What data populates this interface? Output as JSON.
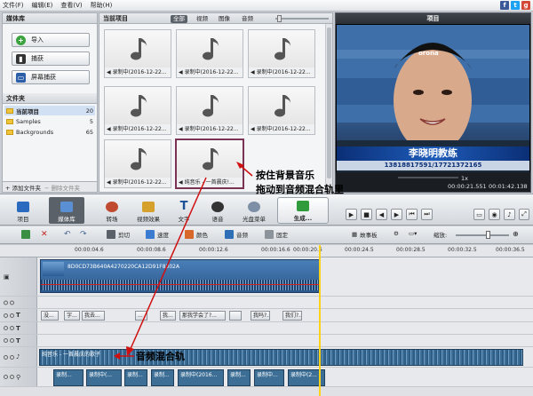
{
  "menu": [
    "文件(F)",
    "编辑(E)",
    "查看(V)",
    "帮助(H)"
  ],
  "social": [
    {
      "label": "f",
      "color": "#3b5998"
    },
    {
      "label": "t",
      "color": "#1da1f2"
    },
    {
      "label": "g",
      "color": "#d34836"
    }
  ],
  "media_library": {
    "title": "媒体库",
    "buttons": [
      "导入",
      "捕获",
      "屏幕捕获"
    ],
    "folders_title": "文件夹",
    "folders": [
      {
        "name": "当前项目",
        "count": "20"
      },
      {
        "name": "Samples",
        "count": "5"
      },
      {
        "name": "Backgrounds",
        "count": "65"
      }
    ],
    "add_folder": "添加文件夹",
    "delete_folder": "删除文件夹"
  },
  "project": {
    "title": "当前项目",
    "filters": [
      "全部",
      "视频",
      "图像",
      "音频"
    ],
    "thumbs": [
      "录制中(2016-12-22...",
      "录制中(2016-12-22...",
      "录制中(2016-12-22...",
      "录制中(2016-12-22...",
      "录制中(2016-12-22...",
      "录制中(2016-12-22...",
      "录制中(2016-12-22...",
      "纯音乐 - 一首晨庆!..."
    ]
  },
  "preview": {
    "title": "项目",
    "video_text": {
      "name": "李晓明教练",
      "phone": "13818817591/17721372165",
      "cap": "orona"
    },
    "speed": "1x",
    "time_current": "00:00:21.551",
    "time_total": "00:01:42.138"
  },
  "toolbar": {
    "buttons": [
      "项目",
      "媒体库",
      "转场",
      "视频效果",
      "文字",
      "语音",
      "光盘菜单",
      "生成..."
    ]
  },
  "timeline": {
    "tools": [
      "剪切",
      "速度",
      "颜色",
      "音频",
      "固定"
    ],
    "storyboard": "故事板",
    "zoom": "缩放:",
    "ruler": [
      "00:00:04.6",
      "00:00:08.6",
      "00:00:12.6",
      "00:00:16.6",
      "00:00:20.6",
      "00:00:24.5",
      "00:00:28.5",
      "00:00:32.5",
      "00:00:36.5"
    ],
    "video_clip": "8D0CD73B640A4270220CA12D91F8302A",
    "text_clips": [
      "没...",
      "字...",
      "我去...",
      "...",
      "我...",
      "那我学会了?...",
      "",
      "我吗?...",
      "我们?..."
    ],
    "audio_clip": "纯音乐 - 一首晨庆的歌子",
    "rec_clips": [
      "录制...",
      "录制中(...",
      "录制...",
      "录制...",
      "录制中(2016...",
      "录制...",
      "录制中...",
      "录制中(2..."
    ]
  },
  "annotations": {
    "drag": [
      "按住背景音乐",
      "拖动到音频混合轨里"
    ],
    "mix": "音频混合轨"
  }
}
